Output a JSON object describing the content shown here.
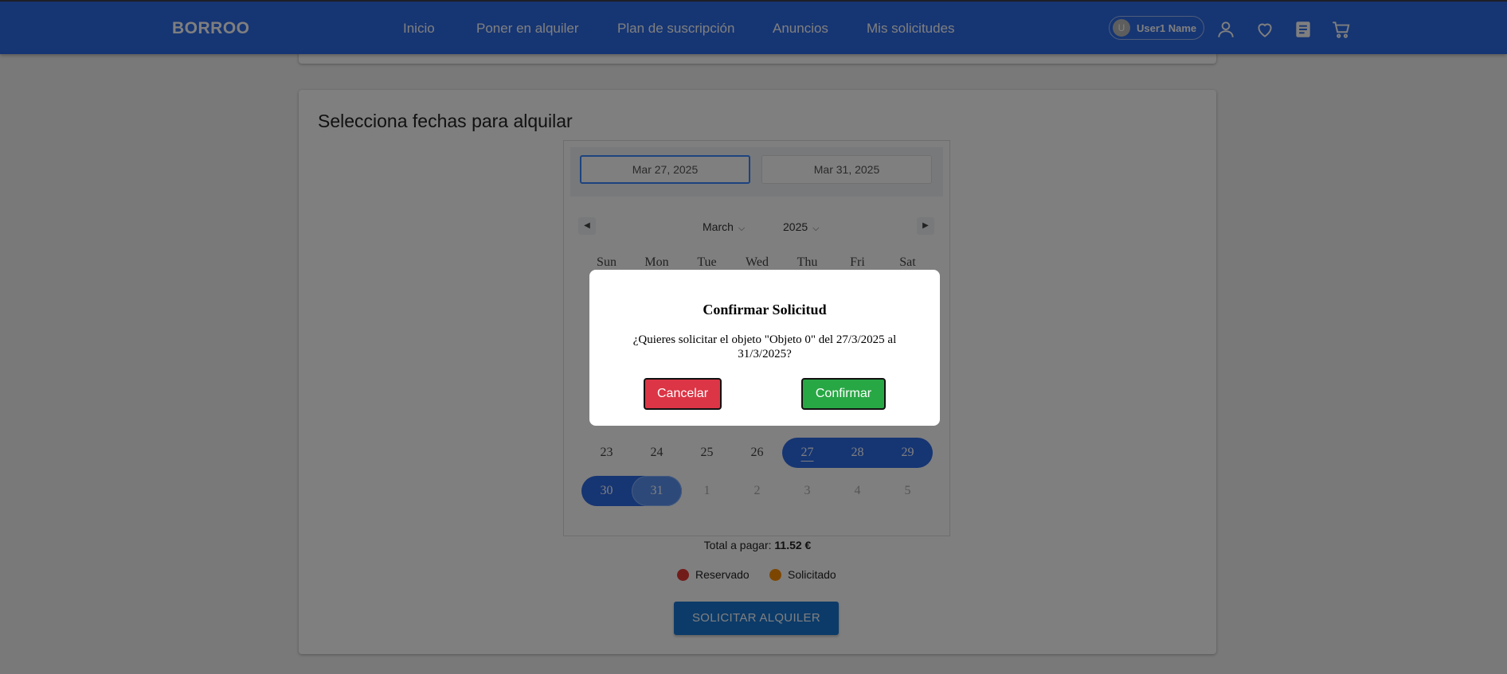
{
  "header": {
    "brand": "BORROO",
    "nav": [
      "Inicio",
      "Poner en alquiler",
      "Plan de suscripción",
      "Anuncios",
      "Mis solicitudes"
    ],
    "user_initial": "U",
    "user_name": "User1 Name",
    "icons": [
      "user-icon",
      "heart-icon",
      "list-icon",
      "cart-icon"
    ],
    "color": "#2c6be6"
  },
  "rental": {
    "title": "Selecciona fechas para alquilar",
    "start_date": "Mar 27, 2025",
    "end_date": "Mar 31, 2025",
    "month": "March",
    "year": "2025",
    "weekdays": [
      "Sun",
      "Mon",
      "Tue",
      "Wed",
      "Thu",
      "Fri",
      "Sat"
    ],
    "week_row_5": [
      "23",
      "24",
      "25",
      "26",
      "27",
      "28",
      "29"
    ],
    "week_row_6": [
      "30",
      "31",
      "1",
      "2",
      "3",
      "4",
      "5"
    ],
    "total_label": "Total a pagar:",
    "total_value": "11.52 €",
    "legend": [
      {
        "label": "Reservado",
        "color": "#e53935"
      },
      {
        "label": "Solicitado",
        "color": "#fb8c00"
      }
    ],
    "submit_label": "SOLICITAR ALQUILER"
  },
  "modal": {
    "title": "Confirmar Solicitud",
    "message": "¿Quieres solicitar el objeto \"Objeto 0\" del 27/3/2025 al 31/3/2025?",
    "cancel_label": "Cancelar",
    "confirm_label": "Confirmar",
    "cancel_color": "#dc3545",
    "confirm_color": "#28a745"
  }
}
